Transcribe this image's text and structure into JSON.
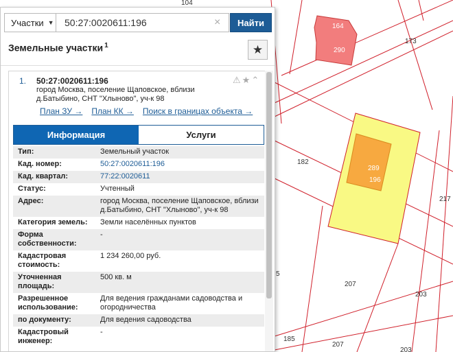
{
  "map": {
    "parcel_labels": [
      "164",
      "290",
      "173",
      "182",
      "289",
      "196",
      "217",
      "207",
      "203",
      "207",
      "185",
      "203"
    ],
    "partial_labels": [
      "5",
      "104"
    ]
  },
  "search": {
    "select_value": "Участки",
    "input_value": "50:27:0020611:196",
    "find_label": "Найти"
  },
  "panel": {
    "title": "Земельные участки",
    "count": "1"
  },
  "card": {
    "number": "1.",
    "cad_number": "50:27:0020611:196",
    "address_line1": "город Москва, поселение Щаповское, вблизи",
    "address_line2": "д.Батыбино, СНТ \"Хлыново\", уч-к 98",
    "links": [
      "План ЗУ →",
      "План КК →",
      "Поиск в границах объекта →"
    ],
    "tabs": [
      "Информация",
      "Услуги"
    ],
    "rows": [
      {
        "k": "Тип:",
        "v": "Земельный участок"
      },
      {
        "k": "Кад. номер:",
        "v": "50:27:0020611:196"
      },
      {
        "k": "Кад. квартал:",
        "v": "77:22:0020611"
      },
      {
        "k": "Статус:",
        "v": "Учтенный"
      },
      {
        "k": "Адрес:",
        "v": "город Москва, поселение Щаповское, вблизи д.Батыбино, СНТ \"Хлыново\", уч-к 98"
      },
      {
        "k": "Категория земель:",
        "v": "Земли населённых пунктов"
      },
      {
        "k": "Форма собственности:",
        "v": "-"
      },
      {
        "k": "Кадастровая стоимость:",
        "v": "1 234 260,00 руб."
      },
      {
        "k": "Уточненная площадь:",
        "v": "500 кв. м"
      },
      {
        "k": "Разрешенное использование:",
        "v": "Для ведения гражданами садоводства и огородничества"
      },
      {
        "k": "по документу:",
        "v": "Для ведения садоводства"
      },
      {
        "k": "Кадастровый инженер:",
        "v": "-"
      }
    ]
  },
  "colors": {
    "accent": "#0f66b3",
    "button": "#1d5c96",
    "parcel_selected": "#f9f984",
    "building_selected": "#f7a940",
    "parcel_red": "#f27d7d",
    "boundary": "#d01f2a"
  }
}
